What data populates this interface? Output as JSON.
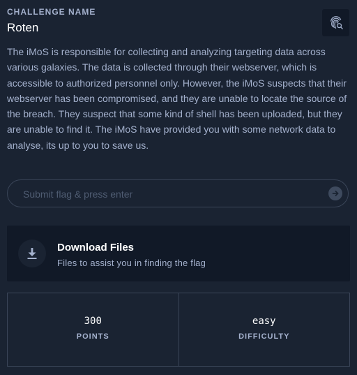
{
  "challenge": {
    "section_label": "CHALLENGE NAME",
    "name": "Roten",
    "description": "The iMoS is responsible for collecting and analyzing targeting data across various galaxies. The data is collected through their webserver, which is accessible to authorized personnel only. However, the iMoS suspects that their webserver has been compromised, and they are unable to locate the source of the breach. They suspect that some kind of shell has been uploaded, but they are unable to find it. The iMoS have provided you with some network data to analyse, its up to you to save us.",
    "action_icon": "fingerprint-search-icon"
  },
  "flag": {
    "placeholder": "Submit flag & press enter",
    "value": "",
    "submit_icon": "arrow-right-icon"
  },
  "download": {
    "title": "Download Files",
    "subtitle": "Files to assist you in finding the flag",
    "icon": "download-icon"
  },
  "stats": {
    "points_value": "300",
    "points_label": "POINTS",
    "difficulty_value": "easy",
    "difficulty_label": "DIFFICULTY"
  },
  "colors": {
    "background": "#1a2332",
    "card": "#111927",
    "text": "#a4b1cd",
    "heading": "#ffffff",
    "border": "#3a4558"
  }
}
